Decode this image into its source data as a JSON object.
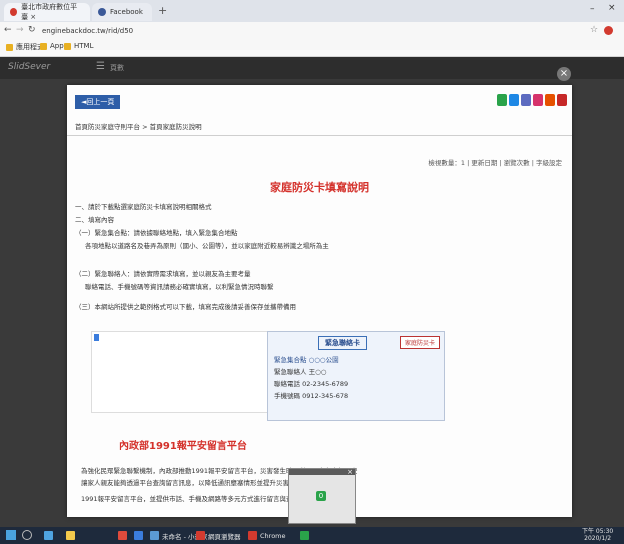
{
  "browser": {
    "tabs": [
      {
        "label": "臺北市政府數位平臺 ×",
        "color": "#d23a2f"
      },
      {
        "label": "Facebook",
        "color": "#3b5998"
      }
    ],
    "new_tab": "+",
    "url": "enginebackdoc.tw/rid/d50",
    "bookmarks": [
      "應用程式",
      "App",
      "HTML"
    ]
  },
  "viewer": {
    "logo": "SlidSever",
    "page_label": "頁數"
  },
  "document": {
    "back_label": "◄回上一頁",
    "social_colors": [
      "#2aa34a",
      "#1e88e5",
      "#5d6bc0",
      "#d6336c",
      "#e65100",
      "#c62828"
    ],
    "breadcrumb": "首頁防災家庭守則平台 > 首頁家庭防災說明",
    "meta": "檢視數量：1 | 更新日期 | 瀏覽次數 | 字級設定",
    "title": "家庭防災卡填寫說明",
    "sections": [
      "一、請於下載點選家庭防災卡填寫說明相關格式",
      "二、填寫內容",
      "（一）緊急集合點：請依據聯絡地點，填入緊急集合地點",
      "各項地點以道路名及巷弄為原則（國小、公園等），並以家庭附近較易辨識之場所為主",
      "（二）緊急聯絡人：請依實際需求填寫，並以親友為主要考量",
      "聯絡電話、手機號碼等資訊請務必確實填寫，以利緊急情況時聯繫",
      "（三）本網站所提供之範例格式可以下載，填寫完成後請妥善保存並攜帶備用"
    ],
    "info_card": {
      "heading": "緊急聯絡卡",
      "tag": "家庭防災卡",
      "rows": [
        "緊急集合點 ○○○公園",
        "緊急聯絡人 王○○",
        "聯絡電話 02-2345-6789",
        "手機號碼 0912-345-678"
      ]
    },
    "subtitle": "內政部1991報平安留言平台",
    "body_lines": [
      "為強化民眾緊急聯繫機制，內政部推動1991報平安留言平台，災害發生時可利用平台留言報平安",
      "讓家人親友能夠透過平台查詢留言訊息，以降低通訊壅塞情形並提升災害應變效率",
      "1991報平安留言平台，並提供市話、手機及網路等多元方式進行留言與查詢服務"
    ]
  },
  "popup": {
    "label": "0"
  },
  "taskbar": {
    "items": [
      {
        "label": "",
        "color": "#4fa3e0"
      },
      {
        "label": "",
        "color": "#f2c94c"
      },
      {
        "label": "",
        "color": "#e04b3c"
      },
      {
        "label": "",
        "color": "#3b7ddd"
      },
      {
        "label": "未命名 - 小畫家",
        "color": "#5b9bd5"
      },
      {
        "label": "網頁瀏覽器",
        "color": "#d23a2f"
      },
      {
        "label": "Chrome",
        "color": "#d23a2f"
      },
      {
        "label": "",
        "color": "#2aa34a"
      }
    ],
    "clock_time": "下午 05:30",
    "clock_date": "2020/1/2"
  }
}
